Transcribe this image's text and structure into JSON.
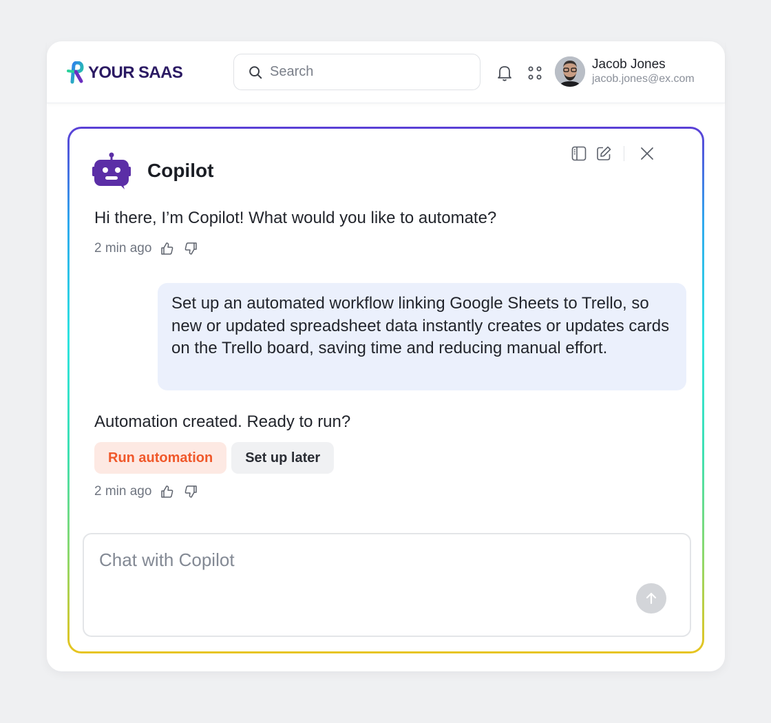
{
  "brand": {
    "name": "YOUR SAAS",
    "color": "#2b1a63"
  },
  "search": {
    "placeholder": "Search"
  },
  "header": {
    "icons": [
      "bell-icon",
      "apps-grid-icon"
    ]
  },
  "user": {
    "name": "Jacob Jones",
    "email": "jacob.jones@ex.com"
  },
  "copilot": {
    "title": "Copilot",
    "tools": [
      "sidebar-toggle-icon",
      "edit-icon",
      "close-icon"
    ],
    "accent": "#5b2ea6"
  },
  "messages": [
    {
      "from": "bot",
      "text": "Hi there, I’m Copilot! What would you like to automate?",
      "time": "2 min ago"
    },
    {
      "from": "user",
      "text": "Set up an automated workflow linking Google Sheets to Trello, so new or updated spreadsheet data instantly creates or updates cards on the Trello board, saving time and reducing manual effort."
    },
    {
      "from": "bot",
      "text": "Automation created. Ready to run?",
      "time": "2 min ago",
      "actions": {
        "primary": "Run automation",
        "secondary": "Set up later"
      }
    }
  ],
  "chat_input": {
    "placeholder": "Chat with Copilot"
  },
  "colors": {
    "primary_action": "#f0582a",
    "user_bubble": "#ebf0fc"
  }
}
